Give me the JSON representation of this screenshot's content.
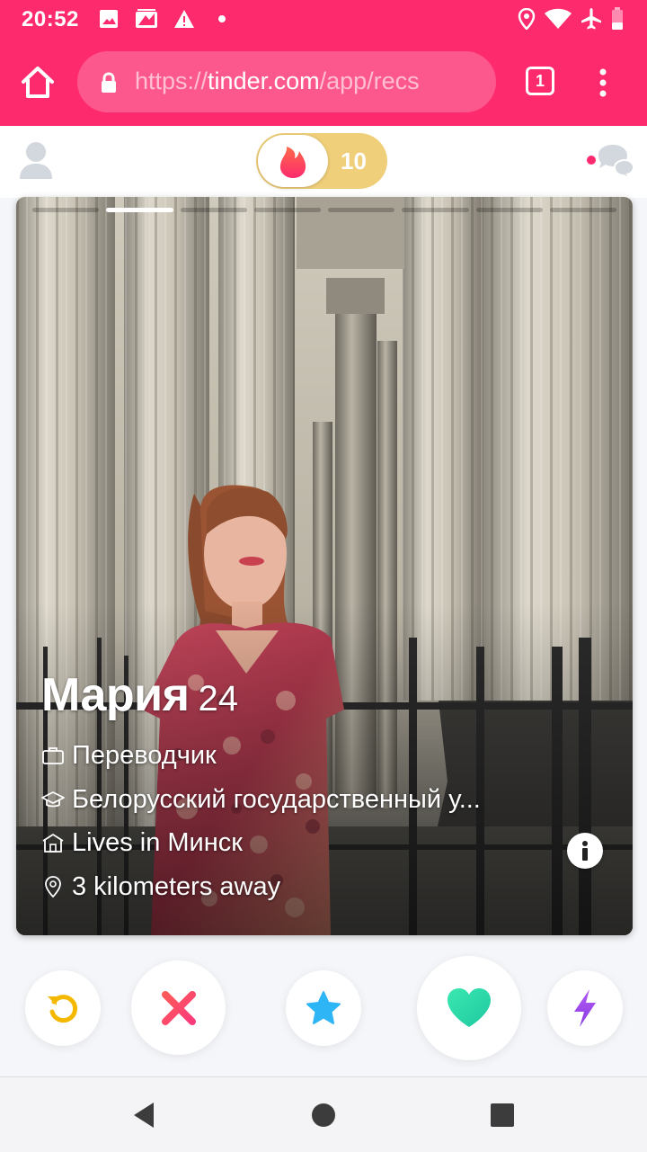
{
  "status_bar": {
    "time": "20:52",
    "left_icons": [
      "image-icon",
      "gallery-icon",
      "warning-icon",
      "dot-icon"
    ],
    "right_icons": [
      "location-icon",
      "wifi-icon",
      "airplane-icon",
      "battery-low-icon"
    ]
  },
  "browser": {
    "url_scheme": "https://",
    "url_domain": "tinder.com",
    "url_path": "/app/recs",
    "tab_count": "1",
    "colors": {
      "toolbar": "#fd2a6e"
    }
  },
  "app_header": {
    "match_count": "10",
    "icons": [
      "profile-icon",
      "flame-icon",
      "messages-icon"
    ],
    "colors": {
      "toggle": "#f0cf7a",
      "flame": "#fd5068",
      "unread_dot": "#fd2a6e"
    }
  },
  "card": {
    "photo_count": 8,
    "active_photo": 2,
    "name": "Мария",
    "age": "24",
    "job": "Переводчик",
    "school": "Белорусский государственный у...",
    "city": "Lives in Минск",
    "distance": "3 kilometers away"
  },
  "actions": [
    {
      "name": "rewind-button",
      "icon": "rewind-icon",
      "color": "#f5b800"
    },
    {
      "name": "nope-button",
      "icon": "x-icon",
      "color": "#fd5068"
    },
    {
      "name": "super-like-button",
      "icon": "star-icon",
      "color": "#2db5f5"
    },
    {
      "name": "like-button",
      "icon": "heart-icon",
      "color": "#2be0a8"
    },
    {
      "name": "boost-button",
      "icon": "bolt-icon",
      "color": "#a34bf0"
    }
  ],
  "nav_bar": {
    "icons": [
      "back-icon",
      "home-icon",
      "recents-icon"
    ]
  }
}
